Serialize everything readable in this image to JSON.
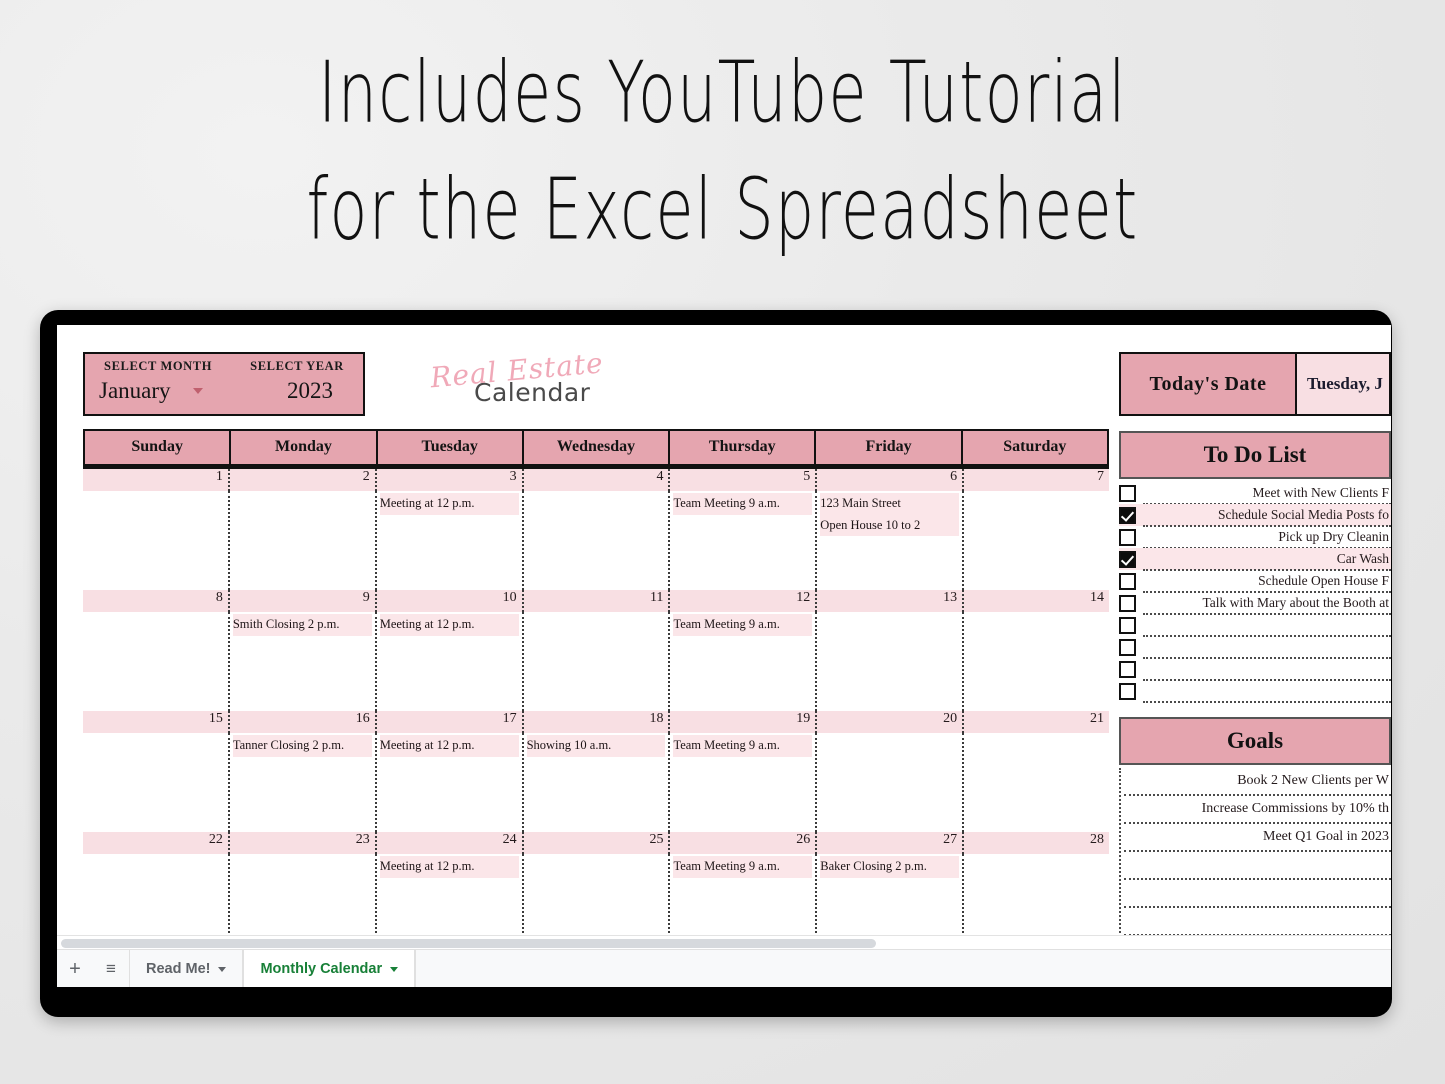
{
  "promo": {
    "line1": "Includes YouTube Tutorial",
    "line2": "for the Excel Spreadsheet"
  },
  "colors": {
    "header_pink": "#e5a5af",
    "band_pink": "#f8dfe3",
    "event_pink": "#fbe6e9",
    "logo_script_pink": "#f0a9b8",
    "active_tab_green": "#188038"
  },
  "selector": {
    "month_label": "SELECT MONTH",
    "year_label": "SELECT YEAR",
    "month_value": "January",
    "year_value": "2023"
  },
  "logo": {
    "script": "Real Estate",
    "word": "Calendar"
  },
  "calendar": {
    "day_headers": [
      "Sunday",
      "Monday",
      "Tuesday",
      "Wednesday",
      "Thursday",
      "Friday",
      "Saturday"
    ],
    "weeks": [
      {
        "numbers": [
          "1",
          "2",
          "3",
          "4",
          "5",
          "6",
          "7"
        ],
        "events": [
          "",
          "",
          "Meeting at 12 p.m.",
          "",
          "Team Meeting 9 a.m.",
          "123 Main Street\nOpen House 10 to 2",
          ""
        ]
      },
      {
        "numbers": [
          "8",
          "9",
          "10",
          "11",
          "12",
          "13",
          "14"
        ],
        "events": [
          "",
          "Smith Closing 2 p.m.",
          "Meeting at 12 p.m.",
          "",
          "Team Meeting 9 a.m.",
          "",
          ""
        ]
      },
      {
        "numbers": [
          "15",
          "16",
          "17",
          "18",
          "19",
          "20",
          "21"
        ],
        "events": [
          "",
          "Tanner Closing 2 p.m.",
          "Meeting at 12 p.m.",
          "Showing 10 a.m.",
          "Team Meeting 9 a.m.",
          "",
          ""
        ]
      },
      {
        "numbers": [
          "22",
          "23",
          "24",
          "25",
          "26",
          "27",
          "28"
        ],
        "events": [
          "",
          "",
          "Meeting at 12 p.m.",
          "",
          "Team Meeting 9 a.m.",
          "Baker Closing 2 p.m.",
          ""
        ]
      }
    ]
  },
  "today": {
    "label": "Today's  Date",
    "value": "Tuesday, J"
  },
  "todo": {
    "title": "To Do List",
    "items": [
      {
        "text": "Meet with New Clients F",
        "checked": false
      },
      {
        "text": "Schedule Social Media Posts fo",
        "checked": true
      },
      {
        "text": "Pick up Dry Cleanin",
        "checked": false
      },
      {
        "text": "Car Wash",
        "checked": true
      },
      {
        "text": "Schedule Open House F",
        "checked": false
      },
      {
        "text": "Talk with Mary about the Booth at",
        "checked": false
      },
      {
        "text": "",
        "checked": false
      },
      {
        "text": "",
        "checked": false
      },
      {
        "text": "",
        "checked": false
      },
      {
        "text": "",
        "checked": false
      }
    ]
  },
  "goals": {
    "title": "Goals",
    "items": [
      "Book 2 New Clients per W",
      "Increase Commissions by 10% th",
      "Meet Q1 Goal in 2023",
      "",
      "",
      "",
      ""
    ]
  },
  "bottom_bar": {
    "add_label": "+",
    "all_sheets_label": "≡",
    "tabs": [
      {
        "label": "Read Me!",
        "active": false
      },
      {
        "label": "Monthly Calendar",
        "active": true
      }
    ]
  }
}
